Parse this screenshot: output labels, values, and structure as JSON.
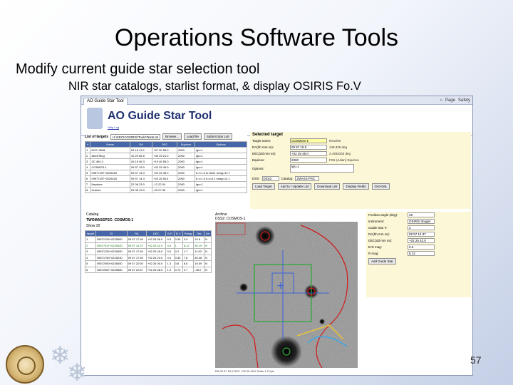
{
  "slide": {
    "title": "Operations Software Tools",
    "bullet1": "Modify current guide star selection tool",
    "bullet2": "NIR star catalogs, starlist format, & display OSIRIS Fo.V",
    "page_number": "57"
  },
  "browser": {
    "tab_title": "AO Guide Star Tool",
    "menu": [
      "Page",
      "Safety"
    ]
  },
  "app": {
    "title": "AO Guide Star Tool",
    "links": "Help  Log"
  },
  "list": {
    "label": "List of targets",
    "file_value": "H:\\KECK\\OSIRIS\\Tools\\Tests.txt",
    "browse": "Browse...",
    "load": "Load file",
    "submit": "Submit Star List",
    "columns": [
      "#",
      "Name",
      "RA",
      "DEC",
      "Equinox",
      "Options"
    ],
    "rows": [
      [
        "1",
        "NGC 5548",
        "09 18 11.0",
        "+67 00 58.0",
        "2000",
        "lgs=1"
      ],
      [
        "2",
        "Abell Ring",
        "10 29 56.5",
        "+39 25 21.0",
        "2000",
        "lgs=1"
      ],
      [
        "3",
        "3C 454.3",
        "16 19 46.3",
        "+19 46 55.0",
        "2000",
        "lgs=1"
      ],
      [
        "4",
        "COSMOS-1",
        "09 57 19.0",
        "+02 25 45.0",
        "2000",
        "lgs=1"
      ],
      [
        "5",
        "09577437+0225420",
        "09 57 14.3",
        "+02 25 45.0",
        "2000",
        "b-r=1.5 ur=8.61 rmag=12.7"
      ],
      [
        "6",
        "09577437+0225420",
        "09 57 14.4",
        "+02 26 54.4",
        "2000",
        "b-r=1.9 b-v=0.2 rmag=12.1"
      ],
      [
        "7",
        "Neptune",
        "22 08 23.0",
        "-12 22 00",
        "2000",
        "lgs=1"
      ],
      [
        "8",
        "Uranus",
        "23 35 19.0",
        "-03 27 55",
        "2000",
        "lgs=1"
      ]
    ]
  },
  "selected": {
    "title": "Selected target",
    "fields": [
      {
        "label": "Target name:",
        "value": "COSMOS-1",
        "extra": "Resolve"
      },
      {
        "label": "RA(hh mm ss):",
        "value": "09 57 19.0",
        "extra": "149.325 deg"
      },
      {
        "label": "DEC(dd mm ss):",
        "value": "+02 25 45.0",
        "extra": "2.4458333 deg"
      },
      {
        "label": "Equinox:",
        "value": "2000",
        "extra": "FK5 (Julian) Equinox"
      },
      {
        "label": "Options:",
        "value": "lgs=1",
        "extra": ""
      }
    ],
    "dss_label": "DSS:",
    "dss_value": "DSS2",
    "catalog_label": "Catalog:",
    "catalog_value": "2MASS-PSC",
    "buttons": [
      "Load Target",
      "Add to / Update List",
      "Download List",
      "Display Fields",
      "Get KML"
    ]
  },
  "catalog": {
    "title": "Catalog",
    "name": "TWOMASSPSC: COSMOS-1",
    "show": "Show 20",
    "columns": [
      "target",
      "ID",
      "RA",
      "DEC",
      "B-R",
      "B-V",
      "Rmag",
      "Dist",
      "Sel"
    ],
    "rows": [
      [
        "1",
        "09571790+0225560",
        "09 57 17.90",
        "+02 25 56.0",
        "0.5",
        "0.33",
        "3.9",
        "10.8",
        "N"
      ],
      [
        "2",
        "09577437+0225420",
        "09 57 14.37",
        "+02 25 42.0",
        "0.5",
        "1",
        "8.12",
        "50.19",
        "N"
      ],
      [
        "3",
        "09571750+0225450",
        "09 57 17.50",
        "+02 25 45.0",
        "0.5",
        "0.2",
        "1.7",
        "11.62",
        "N"
      ],
      [
        "4",
        "09571750+0225230",
        "09 57 17.50",
        "+02 25 23.0",
        "0.4",
        "0.33",
        "7.8",
        "80.48",
        "N"
      ],
      [
        "5",
        "09572050+0226000",
        "09 57 20.50",
        "+02 26 00.0",
        "1.3",
        "0.8",
        "8.6",
        "19.59",
        "N"
      ],
      [
        "6",
        "09572067+0225580",
        "09 57 20.67",
        "+02 25 58.0",
        "1.3",
        "0.72",
        "2.7",
        "-45.2",
        "N"
      ]
    ]
  },
  "image": {
    "archive": "Archive",
    "caption": "DSS2: COSMOS-1",
    "footer": "RA 09 57 19.0   DEC +02 25 45.0   Scale 1.0\"/pix"
  },
  "guide": {
    "fields": [
      {
        "label": "Position angle (deg):",
        "value": "45"
      },
      {
        "label": "Instrument:",
        "value": "OSIRIS Imager"
      },
      {
        "label": "Guide Star #:",
        "value": "2"
      },
      {
        "label": "RA(hh mm ss):",
        "value": "09 57 14.37"
      },
      {
        "label": "DEC(dd mm ss):",
        "value": "+02 25 42.0"
      },
      {
        "label": "B-R mag:",
        "value": "0.5"
      },
      {
        "label": "R mag:",
        "value": "8.12"
      }
    ],
    "add_button": "Add Guide Star"
  },
  "colors": {
    "title_blue": "#1f2f6e",
    "table_header": "#4566a8",
    "panel_yellow": "#fbf7d7",
    "fov_red": "#d21a1a",
    "fov_green": "#2fa83a",
    "fov_blue": "#3d62d8"
  }
}
